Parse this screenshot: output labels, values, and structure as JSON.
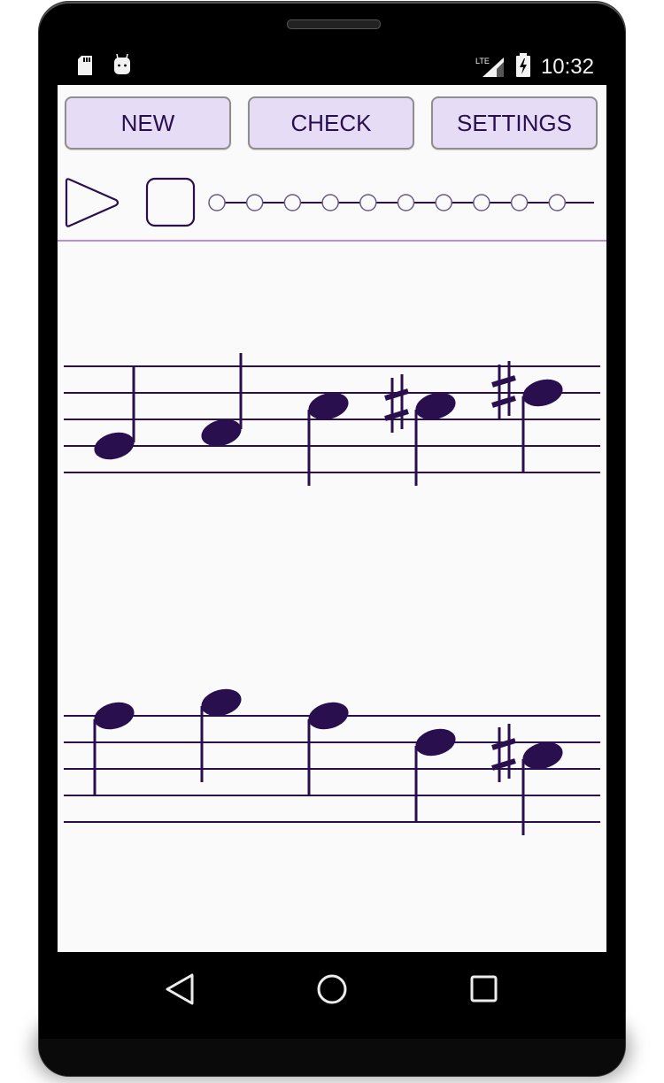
{
  "status_bar": {
    "left_icons": [
      "sd-card-icon",
      "android-debug-icon"
    ],
    "right_icons": [
      "lte-signal-icon",
      "battery-charging-icon"
    ],
    "network_label": "LTE",
    "time": "10:32"
  },
  "toolbar": {
    "buttons": [
      {
        "id": "new",
        "label": "NEW"
      },
      {
        "id": "check",
        "label": "CHECK"
      },
      {
        "id": "settings",
        "label": "SETTINGS"
      }
    ]
  },
  "player": {
    "play_icon": "play-icon",
    "stop_icon": "stop-icon",
    "progress_steps_total": 10,
    "progress_steps_filled": 0
  },
  "colors": {
    "accent": "#2a0f4f",
    "button_bg": "#e6dcf5",
    "divider": "#b38de8",
    "screen_bg": "#fafafa",
    "note_color": "#2a0f4f"
  },
  "score": {
    "clef_shown": false,
    "staves": [
      {
        "notes": [
          {
            "pitch": "G4",
            "step": 2,
            "accidental": "",
            "stem": "up"
          },
          {
            "pitch": "A4",
            "step": 3,
            "accidental": "",
            "stem": "up"
          },
          {
            "pitch": "C5",
            "step": 5,
            "accidental": "",
            "stem": "down"
          },
          {
            "pitch": "C#5",
            "step": 5,
            "accidental": "sharp",
            "stem": "down"
          },
          {
            "pitch": "D#5",
            "step": 6,
            "accidental": "sharp",
            "stem": "down"
          }
        ]
      },
      {
        "notes": [
          {
            "pitch": "F5",
            "step": 8,
            "accidental": "",
            "stem": "down"
          },
          {
            "pitch": "G5",
            "step": 9,
            "accidental": "",
            "stem": "down"
          },
          {
            "pitch": "F5",
            "step": 8,
            "accidental": "",
            "stem": "down"
          },
          {
            "pitch": "D5",
            "step": 6,
            "accidental": "",
            "stem": "down"
          },
          {
            "pitch": "C#5",
            "step": 5,
            "accidental": "sharp",
            "stem": "down"
          }
        ]
      }
    ]
  },
  "nav_bar": {
    "buttons": [
      {
        "id": "back",
        "icon": "back-triangle-icon"
      },
      {
        "id": "home",
        "icon": "home-circle-icon"
      },
      {
        "id": "recents",
        "icon": "recents-square-icon"
      }
    ]
  }
}
